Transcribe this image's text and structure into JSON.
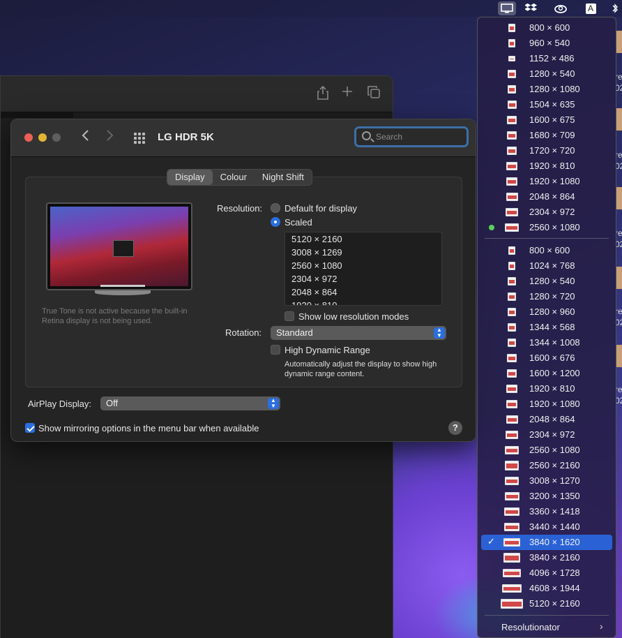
{
  "menubar": {
    "icons": [
      "display-icon",
      "dropbox-icon",
      "creative-cloud-icon",
      "input-source-icon",
      "bluetooth-icon"
    ],
    "input_source_letter": "A"
  },
  "prefs": {
    "title": "LG HDR 5K",
    "search_placeholder": "Search",
    "tabs": [
      "Display",
      "Colour",
      "Night Shift"
    ],
    "true_tone_note": "True Tone is not active because the built-in Retina display is not being used.",
    "resolution_label": "Resolution:",
    "resolution_options": {
      "default": "Default for display",
      "scaled": "Scaled"
    },
    "scaled_list": [
      "5120 × 2160",
      "3008 × 1269",
      "2560 × 1080",
      "2304 × 972",
      "2048 × 864",
      "1920 × 810"
    ],
    "show_low_res": "Show low resolution modes",
    "rotation_label": "Rotation:",
    "rotation_value": "Standard",
    "hdr_label": "High Dynamic Range",
    "hdr_note": "Automatically adjust the display to show high dynamic range content.",
    "airplay_label": "AirPlay Display:",
    "airplay_value": "Off",
    "mirroring_label": "Show mirroring options in the menu bar when available",
    "help_glyph": "?"
  },
  "menu": {
    "group1": [
      "800 × 600",
      "960 × 540",
      "1152 × 486",
      "1280 × 540",
      "1280 × 1080",
      "1504 × 635",
      "1600 × 675",
      "1680 × 709",
      "1720 × 720",
      "1920 × 810",
      "1920 × 1080",
      "2048 × 864",
      "2304 × 972",
      "2560 × 1080"
    ],
    "group1_active": "2560 × 1080",
    "group2": [
      "800 × 600",
      "1024 × 768",
      "1280 × 540",
      "1280 × 720",
      "1280 × 960",
      "1344 × 568",
      "1344 × 1008",
      "1600 × 676",
      "1600 × 1200",
      "1920 × 810",
      "1920 × 1080",
      "2048 × 864",
      "2304 × 972",
      "2560 × 1080",
      "2560 × 2160",
      "3008 × 1270",
      "3200 × 1350",
      "3360 × 1418",
      "3440 × 1440",
      "3840 × 1620",
      "3840 × 2160",
      "4096 × 1728",
      "4608 × 1944",
      "5120 × 2160"
    ],
    "group2_selected": "3840 × 1620",
    "footer": "Resolutionator",
    "edge_letters": [
      "re",
      "02",
      "re",
      "02",
      "re",
      "02",
      "re",
      "02",
      "re",
      "02"
    ]
  }
}
